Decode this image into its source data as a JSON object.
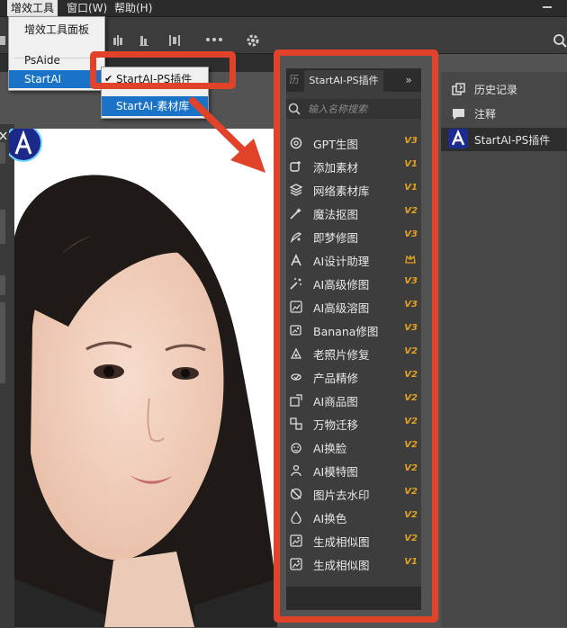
{
  "menubar": {
    "plugins": "增效工具",
    "window": "窗口(W)",
    "help": "帮助(H)"
  },
  "dropdown": {
    "items": [
      "增效工具面板",
      "PsAide",
      "StartAI"
    ]
  },
  "submenu": {
    "items": [
      "StartAI-PS插件",
      "StartAI-素材库"
    ],
    "checked_mark": "✔"
  },
  "panel": {
    "tab_prev": "历",
    "tab_active": "StartAI-PS插件",
    "tab_more": "»",
    "search_placeholder": "输入名称搜索",
    "tools": [
      {
        "label": "GPT生图",
        "version": "V3",
        "icon": "gpt-icon"
      },
      {
        "label": "添加素材",
        "version": "V1",
        "icon": "add-material-icon"
      },
      {
        "label": "网络素材库",
        "version": "V1",
        "icon": "layers-icon"
      },
      {
        "label": "魔法抠图",
        "version": "V2",
        "icon": "magic-cutout-icon"
      },
      {
        "label": "即梦修图",
        "version": "V3",
        "icon": "dream-retouch-icon"
      },
      {
        "label": "AI设计助理",
        "version": "",
        "icon": "ai-design-assistant-icon"
      },
      {
        "label": "AI高级修图",
        "version": "V3",
        "icon": "sparkle-wand-icon"
      },
      {
        "label": "AI高级溶图",
        "version": "V3",
        "icon": "image-blend-icon"
      },
      {
        "label": "Banana修图",
        "version": "V3",
        "icon": "image-edit-icon"
      },
      {
        "label": "老照片修复",
        "version": "V2",
        "icon": "photo-restore-icon"
      },
      {
        "label": "产品精修",
        "version": "V2",
        "icon": "product-retouch-icon"
      },
      {
        "label": "AI商品图",
        "version": "V2",
        "icon": "product-image-icon"
      },
      {
        "label": "万物迁移",
        "version": "V2",
        "icon": "transfer-icon"
      },
      {
        "label": "AI换脸",
        "version": "V2",
        "icon": "face-swap-icon"
      },
      {
        "label": "AI模特图",
        "version": "V2",
        "icon": "model-icon"
      },
      {
        "label": "图片去水印",
        "version": "V2",
        "icon": "remove-watermark-icon"
      },
      {
        "label": "AI换色",
        "version": "V2",
        "icon": "color-change-icon"
      },
      {
        "label": "生成相似图",
        "version": "V2",
        "icon": "similar-image-icon"
      },
      {
        "label": "生成相似图",
        "version": "V1",
        "icon": "similar-image-icon"
      }
    ]
  },
  "right_dock": {
    "items": [
      {
        "label": "历史记录",
        "icon": "history-icon"
      },
      {
        "label": "注释",
        "icon": "comment-icon"
      },
      {
        "label": "StartAI-PS插件",
        "icon": "startai-logo-icon"
      }
    ]
  },
  "colors": {
    "highlight": "#e0422a",
    "version_badge": "#e2a21f",
    "menu_selected": "#1a73c7"
  }
}
